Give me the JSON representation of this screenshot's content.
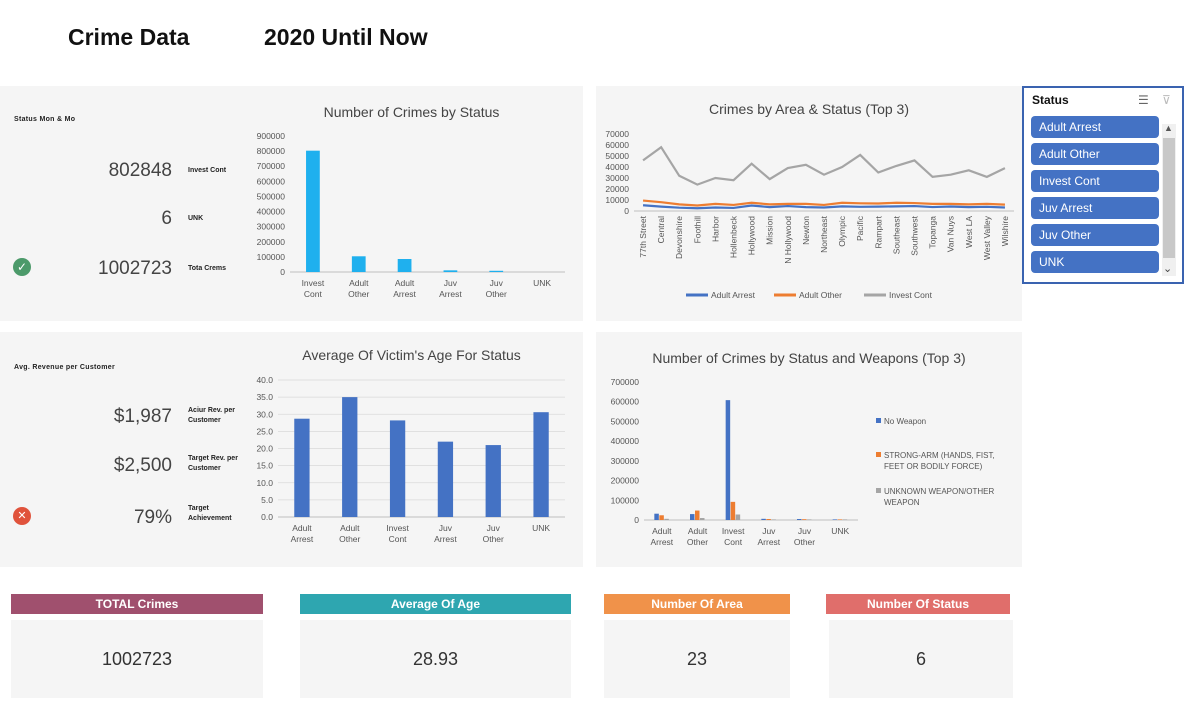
{
  "header": {
    "title": "Crime Data",
    "subtitle": "2020 Until Now"
  },
  "kpi1": {
    "heading": "Status Mon & Mo",
    "rows": [
      {
        "value": "802848",
        "label": "Invest Cont"
      },
      {
        "value": "6",
        "label": "UNK"
      },
      {
        "value": "1002723",
        "label": "Tota Crems"
      }
    ],
    "icon": "check-circle-icon"
  },
  "kpi2": {
    "heading": "Avg. Revenue per Customer",
    "rows": [
      {
        "value": "$1,987",
        "label": "Aciur Rev. per Customer"
      },
      {
        "value": "$2,500",
        "label": "Target Rev. per Customer"
      },
      {
        "value": "79%",
        "label": "Target Achievement"
      }
    ],
    "icon": "x-circle-icon"
  },
  "slicer": {
    "title": "Status",
    "items": [
      "Adult Arrest",
      "Adult Other",
      "Invest Cont",
      "Juv Arrest",
      "Juv Other",
      "UNK"
    ]
  },
  "cards": [
    {
      "title": "TOTAL Crimes",
      "value": "1002723",
      "color": "#a0506e"
    },
    {
      "title": "Average Of Age",
      "value": "28.93",
      "color": "#2ea6b0"
    },
    {
      "title": "Number Of Area",
      "value": "23",
      "color": "#f0924a"
    },
    {
      "title": "Number Of Status",
      "value": "6",
      "color": "#e06e6b"
    }
  ],
  "chart_data": [
    {
      "type": "bar",
      "title": "Number of Crimes by Status",
      "categories": [
        "Invest Cont",
        "Adult Other",
        "Adult Arrest",
        "Juv Arrest",
        "Juv Other",
        "UNK"
      ],
      "values": [
        802848,
        104000,
        86000,
        11000,
        8000,
        6
      ],
      "ylim": [
        0,
        900000
      ],
      "yticks": [
        "0",
        "100000",
        "200000",
        "300000",
        "400000",
        "500000",
        "600000",
        "700000",
        "800000",
        "900000"
      ],
      "color": "#1fb0ee",
      "grid": false
    },
    {
      "type": "line",
      "title": "Crimes by Area & Status (Top 3)",
      "categories": [
        "77th Street",
        "Central",
        "Devonshire",
        "Foothill",
        "Harbor",
        "Hollenbeck",
        "Hollywood",
        "Mission",
        "N Hollywood",
        "Newton",
        "Northeast",
        "Olympic",
        "Pacific",
        "Rampart",
        "Southeast",
        "Southwest",
        "Topanga",
        "Van Nuys",
        "West LA",
        "West Valley",
        "Wilshire"
      ],
      "series": [
        {
          "name": "Adult Arrest",
          "color": "#4472c4",
          "values": [
            5200,
            4000,
            3000,
            2500,
            3200,
            2800,
            5000,
            3500,
            4500,
            3500,
            3200,
            4200,
            3800,
            4000,
            4200,
            4500,
            3600,
            4100,
            3500,
            3800,
            3200
          ]
        },
        {
          "name": "Adult Other",
          "color": "#ed7d31",
          "values": [
            9500,
            8000,
            6000,
            5000,
            6500,
            5500,
            7500,
            6000,
            6500,
            6500,
            5500,
            7500,
            7000,
            6800,
            7500,
            7200,
            6500,
            6500,
            6000,
            6500,
            5800
          ]
        },
        {
          "name": "Invest Cont",
          "color": "#a5a5a5",
          "values": [
            46000,
            58000,
            32000,
            24000,
            30000,
            28000,
            43000,
            29000,
            39000,
            42000,
            33000,
            40000,
            51000,
            35000,
            41000,
            46000,
            31000,
            33000,
            37000,
            31000,
            39000
          ]
        }
      ],
      "ylim": [
        0,
        70000
      ],
      "yticks": [
        "0",
        "10000",
        "20000",
        "30000",
        "40000",
        "50000",
        "60000",
        "70000"
      ],
      "legend": "bottom"
    },
    {
      "type": "bar",
      "title": "Average Of Victim's Age For Status",
      "categories": [
        "Adult Arrest",
        "Adult Other",
        "Invest Cont",
        "Juv Arrest",
        "Juv Other",
        "UNK"
      ],
      "values": [
        28.7,
        35.0,
        28.2,
        22.0,
        21.0,
        30.6
      ],
      "ylim": [
        0,
        40
      ],
      "yticks": [
        "0.0",
        "5.0",
        "10.0",
        "15.0",
        "20.0",
        "25.0",
        "30.0",
        "35.0",
        "40.0"
      ],
      "color": "#4472c4",
      "grid": true
    },
    {
      "type": "bar",
      "title": "Number of Crimes by Status and Weapons (Top 3)",
      "categories": [
        "Adult Arrest",
        "Adult Other",
        "Invest Cont",
        "Juv Arrest",
        "Juv Other",
        "UNK"
      ],
      "series": [
        {
          "name": "No Weapon",
          "color": "#4472c4",
          "values": [
            32000,
            30000,
            608000,
            6000,
            5000,
            2
          ]
        },
        {
          "name": "STRONG-ARM (HANDS, FIST, FEET OR BODILY FORCE)",
          "color": "#ed7d31",
          "values": [
            24000,
            48000,
            92000,
            5000,
            4000,
            1
          ]
        },
        {
          "name": "UNKNOWN WEAPON/OTHER WEAPON",
          "color": "#a5a5a5",
          "values": [
            6000,
            10000,
            28000,
            1000,
            1000,
            1
          ]
        }
      ],
      "ylim": [
        0,
        700000
      ],
      "yticks": [
        "0",
        "100000",
        "200000",
        "300000",
        "400000",
        "500000",
        "600000",
        "700000"
      ],
      "legend": "right"
    }
  ]
}
